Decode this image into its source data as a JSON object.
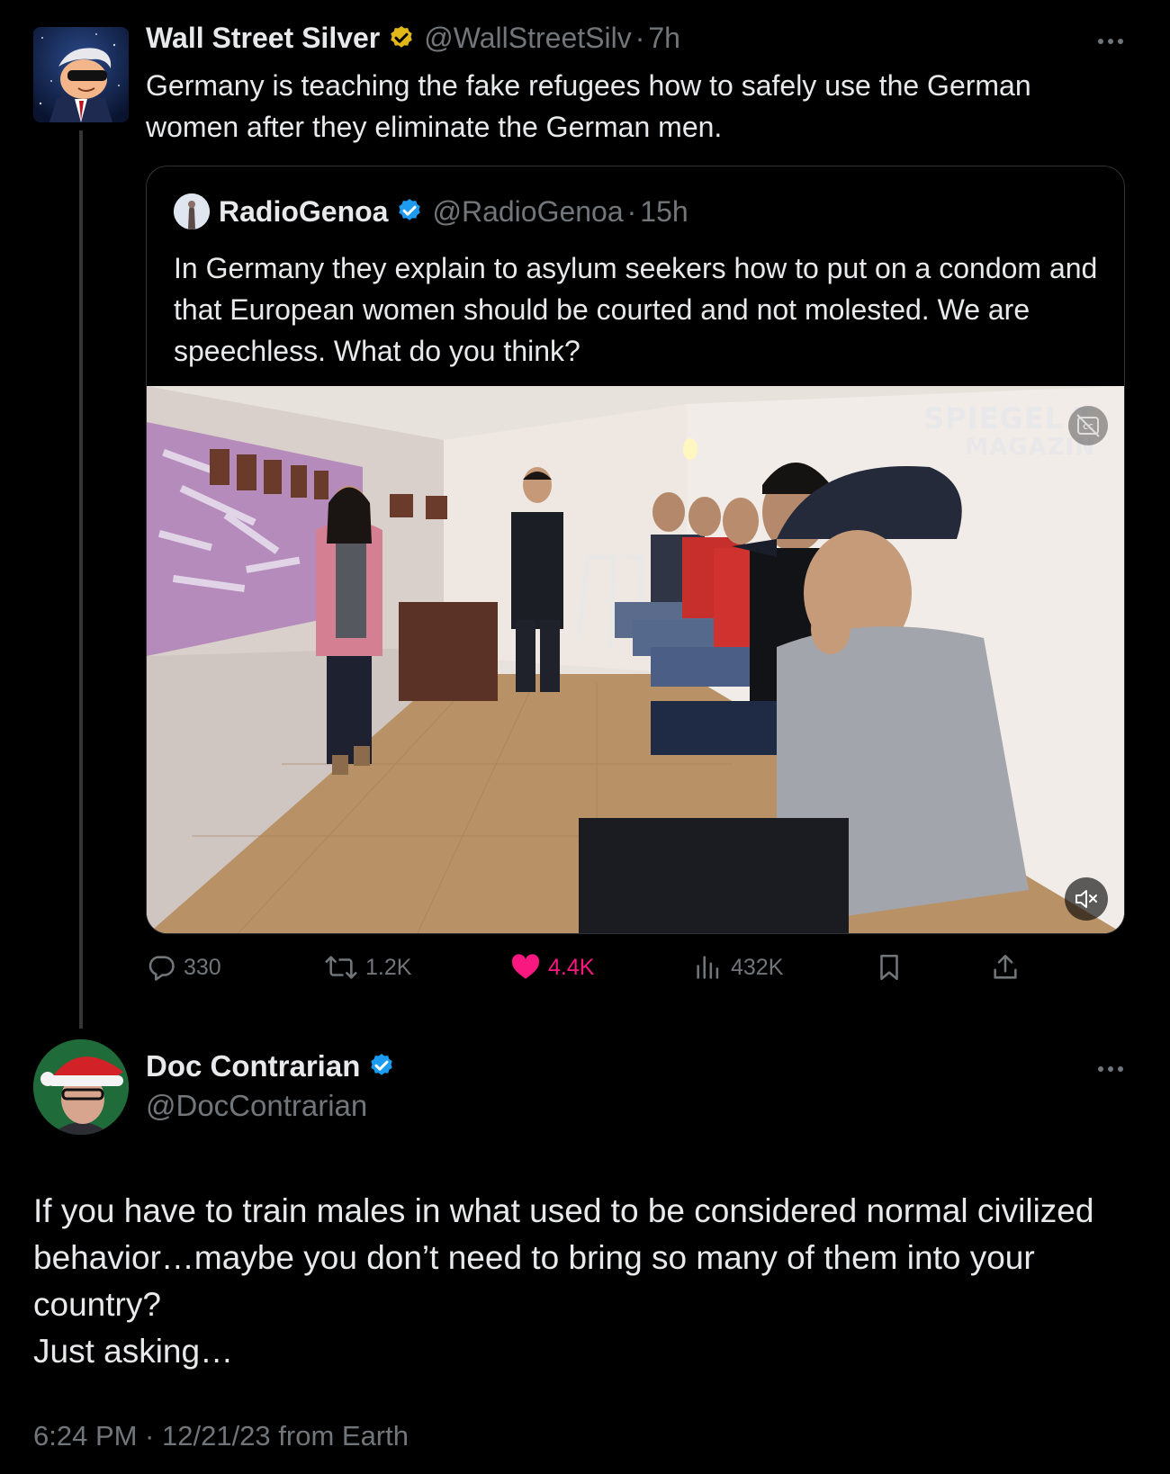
{
  "parent_tweet": {
    "author_name": "Wall Street Silver",
    "handle": "@WallStreetSilv",
    "separator": "·",
    "time_ago": "7h",
    "verified_badge": "gold-check-badge",
    "text": "Germany is teaching the fake refugees how to safely use the German women after they eliminate the German men."
  },
  "quoted_tweet": {
    "author_name": "RadioGenoa",
    "handle": "@RadioGenoa",
    "separator": "·",
    "time_ago": "15h",
    "verified_badge": "blue-check-badge",
    "text": "In Germany they explain to asylum seekers how to put on a condom and that European women should be courted and not molested. We are speechless. What do you think?",
    "video": {
      "watermark_line1": "SPIEGEL T",
      "watermark_line2": "MAGAZIN",
      "captions_icon": "closed-captions-icon",
      "mute_icon": "muted-speaker-icon"
    }
  },
  "actions": {
    "replies": "330",
    "reposts": "1.2K",
    "likes": "4.4K",
    "views": "432K",
    "liked": true,
    "like_color": "#f91880",
    "icons": [
      "reply-icon",
      "repost-icon",
      "heart-icon",
      "views-icon",
      "bookmark-icon",
      "share-icon"
    ]
  },
  "reply_tweet": {
    "author_name": "Doc Contrarian",
    "handle": "@DocContrarian",
    "verified_badge": "blue-check-badge",
    "text_lines": [
      "If you have to train males in what used to be considered normal civilized behavior…maybe you don’t need to bring so many of them into your country?",
      "Just asking…"
    ],
    "meta": "6:24 PM · 12/21/23 from Earth"
  },
  "colors": {
    "background": "#000000",
    "primary_text": "#e7e9ea",
    "secondary_text": "#71767b",
    "border": "#2f3336",
    "verified_blue": "#1d9bf0",
    "verified_gold": "#e2b719"
  }
}
